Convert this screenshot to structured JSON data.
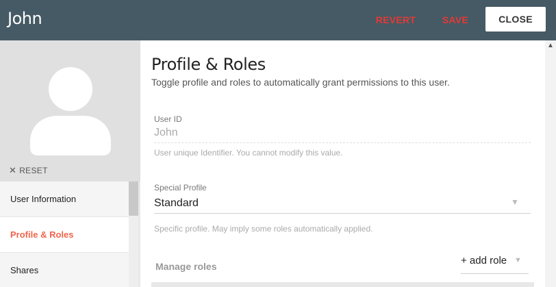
{
  "header": {
    "title": "John",
    "revert_label": "REVERT",
    "save_label": "SAVE",
    "close_label": "CLOSE"
  },
  "sidebar": {
    "reset_icon": "✕",
    "reset_label": "RESET",
    "items": [
      {
        "label": "User Information",
        "active": false
      },
      {
        "label": "Profile & Roles",
        "active": true
      },
      {
        "label": "Shares",
        "active": false
      }
    ]
  },
  "main": {
    "title": "Profile & Roles",
    "subtitle": "Toggle profile and roles to automatically grant permissions to this user.",
    "user_id": {
      "label": "User ID",
      "value": "John",
      "help": "User unique Identifier. You cannot modify this value."
    },
    "special_profile": {
      "label": "Special Profile",
      "value": "Standard",
      "help": "Specific profile. May imply some roles automatically applied."
    },
    "manage_roles": {
      "label": "Manage roles",
      "add_role_label": "+ add role"
    }
  },
  "colors": {
    "header_bg": "#455a64",
    "accent_red": "#e53935",
    "active_nav": "#f0644a"
  },
  "icons": {
    "avatar": "user-avatar-icon",
    "reset": "close-icon",
    "caret": "caret-down-icon",
    "scroll_up": "chevron-up-icon"
  }
}
